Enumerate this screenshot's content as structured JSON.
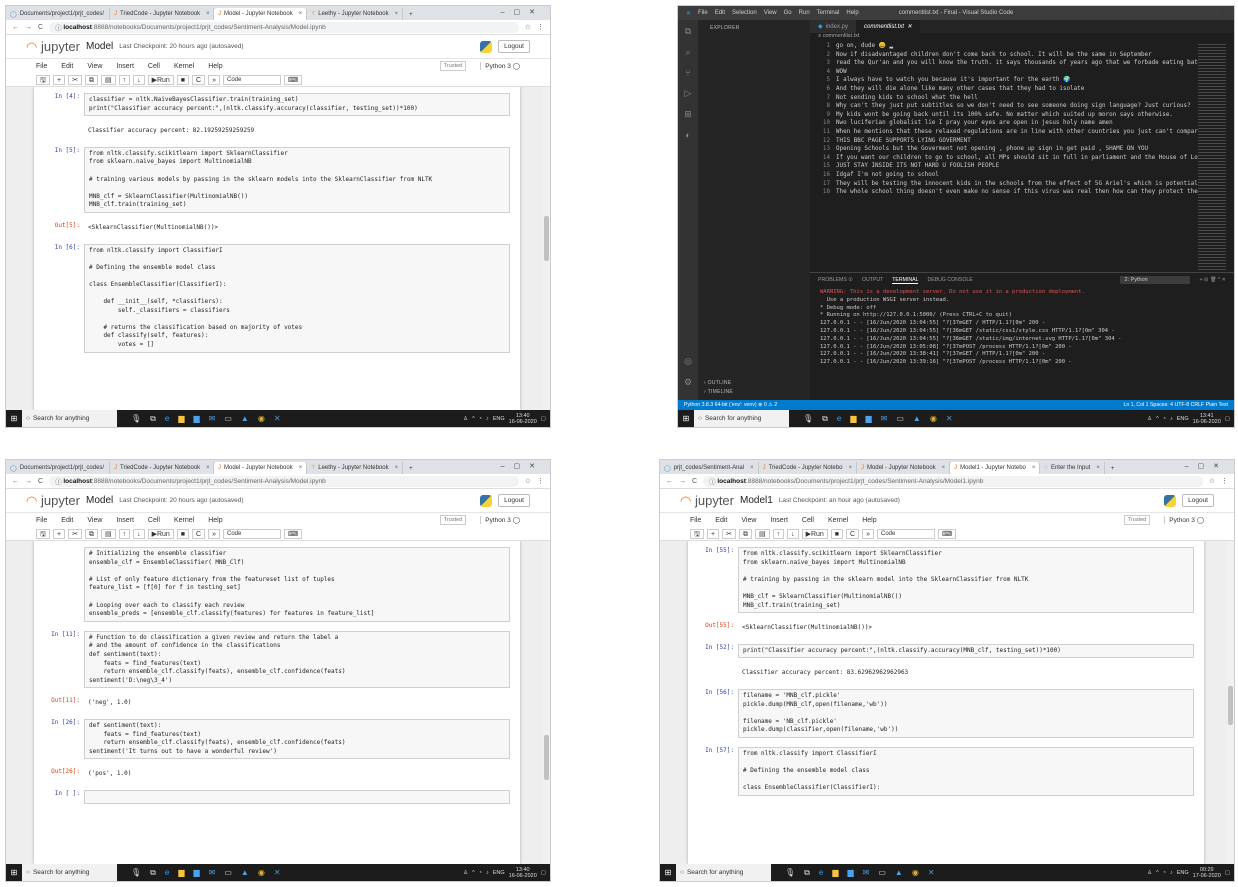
{
  "q1": {
    "tabs": [
      {
        "icon": "◯",
        "label": "Documents/project1/prjt_codes/"
      },
      {
        "icon": "J",
        "label": "TriedCode - Jupyter Notebook"
      },
      {
        "icon": "J",
        "label": "Model - Jupyter Notebook"
      },
      {
        "icon": "Y",
        "label": "Leethy - Jupyter Notebook"
      }
    ],
    "url_host": "localhost",
    "url_rest": ":8888/notebooks/Documents/project1/prjt_codes/Sentiment-Analysis/Model.ipynb",
    "nb_name": "Model",
    "checkpoint": "Last Checkpoint: 20 hours ago  (autosaved)",
    "cells": [
      {
        "p": "In [4]:",
        "type": "in",
        "code": "classifier = nltk.NaiveBayesClassifier.train(training_set)\nprint(\"Classifier accuracy percent:\",(nltk.classify.accuracy(classifier, testing_set))*100)"
      },
      {
        "p": "",
        "type": "out",
        "code": "Classifier accuracy percent: 82.19259259259259"
      },
      {
        "p": "In [5]:",
        "type": "in",
        "code": "from nltk.classify.scikitlearn import SklearnClassifier\nfrom sklearn.naive_bayes import MultinomialNB\n\n# training various models by passing in the sklearn models into the SklearnClassifier from NLTK\n\nMNB_clf = SklearnClassifier(MultinomialNB())\nMNB_clf.train(training_set)"
      },
      {
        "p": "Out[5]:",
        "type": "out",
        "code": "<SklearnClassifier(MultinomialNB())>"
      },
      {
        "p": "In [6]:",
        "type": "in",
        "code": "from nltk.classify import ClassifierI\n\n# Defining the ensemble model class\n\nclass EnsembleClassifier(ClassifierI):\n\n    def __init__(self, *classifiers):\n        self._classifiers = classifiers\n\n    # returns the classification based on majority of votes\n    def classify(self, features):\n        votes = []"
      }
    ],
    "clock_time": "13:40",
    "clock_date": "16-06-2020"
  },
  "q2": {
    "menu": [
      "File",
      "Edit",
      "Selection",
      "View",
      "Go",
      "Run",
      "Terminal",
      "Help"
    ],
    "title": "commentlist.txt - Final - Visual Studio Code",
    "explorer": [
      {
        "t": "EXPLORER",
        "c": "ex-h"
      },
      {
        "t": "∨ OPEN EDITORS",
        "c": "ex-h"
      },
      {
        "t": "      ◆ index.py                                    2",
        "c": ""
      },
      {
        "t": "   ✕ ≡ commentlist.txt",
        "c": ""
      },
      {
        "t": "∨ FINAL",
        "c": "ex-h"
      },
      {
        "t": "   › env",
        "c": ""
      },
      {
        "t": "   › static",
        "c": ""
      },
      {
        "t": "   ∨ templates",
        "c": ""
      },
      {
        "t": "      ◇ index1.html",
        "c": ""
      },
      {
        "t": "   {} client_secret.json",
        "c": ""
      },
      {
        "t": "   ≡ commentlist.txt",
        "c": "ex-sel"
      },
      {
        "t": "   ◆ index.py                                    2",
        "c": ""
      },
      {
        "t": "   ≡ MNB_clf.pickle",
        "c": ""
      },
      {
        "t": "   ≡ Model.ipynb",
        "c": ""
      },
      {
        "t": "   ≡ token.pickle",
        "c": ""
      },
      {
        "t": "   ◆ twitter-scraper.py",
        "c": ""
      },
      {
        "t": "   ◆ youtube_scraper.py",
        "c": ""
      }
    ],
    "outline": "› OUTLINE",
    "timeline": "› TIMELINE",
    "tab1": "index.py",
    "tab2": "commentlist.txt",
    "crumb": "≡ commentlist.txt",
    "lines": [
      "go on, dude 😀 ▂",
      "Now if disadvantaged children don't come back to school. It will be the same in September",
      "read the Qur'an and you will know the truth.  it says thousands of years ago that we forbade eating bats",
      "WOW",
      "I always have to watch you because it's important for the earth 🌍",
      "And they will die alone like many other cases that they had to isolate",
      "Not sending kids to school what the hell",
      "Why can't they just put subtitles so we don't need to see someone doing sign language? Just curious?",
      "My kids wont be going back until its 100% safe. No matter which suited up moron says otherwise.",
      "Nwo luciferian globalist lie I pray your eyes are open in jesus holy name amen",
      "When he mentions that these relaxed regulations are in line with other countries you just can't compare t",
      "THIS BBC PAGE SUPPORTS LYING GOVERMENT",
      "Opening Schools but the Goverment not opening , phone up sign in get paid ,       SHAME ON YOU",
      "If you want our children to go to school, all MPs should sit in full in parliament and the House of Lords",
      "JUST STAY INSIDE ITS NOT HARD U FOOLISH PEOPLE",
      "Idgaf I'm not going to school",
      "They will be testing the innocent kids in the schools from the effect of 5G Ariel's which is potentially",
      "The whole school thing doesn't even make no sense if this virus was real then how can they protect the va"
    ],
    "ptabs": [
      "PROBLEMS ②",
      "OUTPUT",
      "TERMINAL",
      "DEBUG CONSOLE"
    ],
    "pysel": "2: Python",
    "term": [
      {
        "c": "warn",
        "t": "WARNING: This is a development server. Do not use it in a production deployment."
      },
      {
        "c": "",
        "t": "  Use a production WSGI server instead."
      },
      {
        "c": "",
        "t": "* Debug mode: off"
      },
      {
        "c": "",
        "t": "* Running on http://127.0.0.1:5000/ (Press CTRL+C to quit)"
      },
      {
        "c": "",
        "t": "127.0.0.1 - - [16/Jun/2020 13:04:55] \"?[37mGET / HTTP/1.1?[0m\" 200 -"
      },
      {
        "c": "",
        "t": "127.0.0.1 - - [16/Jun/2020 13:04:55] \"?[36mGET /static/css1/style.css HTTP/1.1?[0m\" 304 -"
      },
      {
        "c": "",
        "t": "127.0.0.1 - - [16/Jun/2020 13:04:55] \"?[36mGET /static/img/internet.svg HTTP/1.1?[0m\" 304 -"
      },
      {
        "c": "",
        "t": "127.0.0.1 - - [16/Jun/2020 13:05:08] \"?[37mPOST /process HTTP/1.1?[0m\" 200 -"
      },
      {
        "c": "",
        "t": "127.0.0.1 - - [16/Jun/2020 13:38:41] \"?[37mGET / HTTP/1.1?[0m\" 200 -"
      },
      {
        "c": "",
        "t": "127.0.0.1 - - [16/Jun/2020 13:39:16] \"?[37mPOST /process HTTP/1.1?[0m\" 200 -"
      }
    ],
    "status_left": "Python 3.8.3 64-bit ('env': venv)   ⊗ 0 ⚠ 2",
    "status_right": "Ln 1, Col 1   Spaces: 4   UTF-8   CRLF   Plain Text",
    "clock_time": "13:41",
    "clock_date": "16-06-2020"
  },
  "q3": {
    "tabs": [
      {
        "icon": "◯",
        "label": "Documents/project1/prjt_codes/"
      },
      {
        "icon": "J",
        "label": "TriedCode - Jupyter Notebook"
      },
      {
        "icon": "J",
        "label": "Model - Jupyter Notebook"
      },
      {
        "icon": "Y",
        "label": "Leethy - Jupyter Notebook"
      }
    ],
    "url_host": "localhost",
    "url_rest": ":8888/notebooks/Documents/project1/prjt_codes/Sentiment-Analysis/Model.ipynb",
    "nb_name": "Model",
    "checkpoint": "Last Checkpoint: 20 hours ago  (autosaved)",
    "cells": [
      {
        "p": "",
        "type": "in",
        "code": "# Initializing the ensemble classifier\nensemble_clf = EnsembleClassifier( MNB_Clf)\n\n# List of only feature dictionary from the featureset list of tuples\nfeature_list = [f[0] for f in testing_set]\n\n# Looping over each to classify each review\nensemble_preds = [ensemble_clf.classify(features) for features in feature_list]"
      },
      {
        "p": "In [11]:",
        "type": "in",
        "code": "# Function to do classification a given review and return the label a\n# and the amount of confidence in the classifications\ndef sentiment(text):\n    feats = find_features(text)\n    return ensemble_clf.classify(feats), ensemble_clf.confidence(feats)\nsentiment('D:\\neg\\3_4')"
      },
      {
        "p": "Out[11]:",
        "type": "out",
        "code": "('neg', 1.0)"
      },
      {
        "p": "In [26]:",
        "type": "in",
        "code": "def sentiment(text):\n    feats = find_features(text)\n    return ensemble_clf.classify(feats), ensemble_clf.confidence(feats)\nsentiment('It turns out to have a wonderful review')"
      },
      {
        "p": "Out[26]:",
        "type": "out",
        "code": "('pos', 1.0)"
      },
      {
        "p": "In [ ]:",
        "type": "in",
        "code": " "
      }
    ],
    "clock_time": "13:40",
    "clock_date": "16-06-2020"
  },
  "q4": {
    "tabs": [
      {
        "icon": "◯",
        "label": "prjt_codes/Sentiment-Anal"
      },
      {
        "icon": "J",
        "label": "TriedCode - Jupyter Notebo"
      },
      {
        "icon": "J",
        "label": "Model - Jupyter Notebook"
      },
      {
        "icon": "J",
        "label": "Model1 - Jupyter Notebo"
      },
      {
        "icon": "◌",
        "label": "Enter the Input"
      }
    ],
    "url_host": "localhost",
    "url_rest": ":8888/notebooks/Documents/project1/prjt_codes/Sentiment-Analysis/Model1.ipynb",
    "nb_name": "Model1",
    "checkpoint": "Last Checkpoint: an hour ago  (autosaved)",
    "cells": [
      {
        "p": "In [55]:",
        "type": "in",
        "code": "from nltk.classify.scikitlearn import SklearnClassifier\nfrom sklearn.naive_bayes import MultinomialNB\n\n# training by passing in the sklearn model into the SklearnClassifier from NLTK\n\nMNB_clf = SklearnClassifier(MultinomialNB())\nMNB_clf.train(training_set)"
      },
      {
        "p": "Out[55]:",
        "type": "out",
        "code": "<SklearnClassifier(MultinomialNB())>"
      },
      {
        "p": "In [52]:",
        "type": "in",
        "code": "print(\"Classifier accuracy percent:\",(nltk.classify.accuracy(MNB_clf, testing_set))*100)"
      },
      {
        "p": "",
        "type": "out",
        "code": "Classifier accuracy percent: 83.62962962962963"
      },
      {
        "p": "In [56]:",
        "type": "in",
        "code": "filename = 'MNB_clf.pickle'\npickle.dump(MNB_clf,open(filename,'wb'))\n\nfilename = 'NB_clf.pickle'\npickle.dump(classifier,open(filename,'wb'))"
      },
      {
        "p": "In [57]:",
        "type": "in",
        "code": "from nltk.classify import ClassifierI\n\n# Defining the ensemble model class\n\nclass EnsembleClassifier(ClassifierI):"
      }
    ],
    "clock_time": "00:29",
    "clock_date": "17-06-2020"
  },
  "common": {
    "jupyter": "jupyter",
    "logout": "Logout",
    "menus": [
      "File",
      "Edit",
      "View",
      "Insert",
      "Cell",
      "Kernel",
      "Help"
    ],
    "trusted": "Trusted",
    "kernel": "Python 3 ◯",
    "run": "▶Run",
    "celltype": "Code",
    "search": "Search for anything",
    "lang": "ENG"
  }
}
